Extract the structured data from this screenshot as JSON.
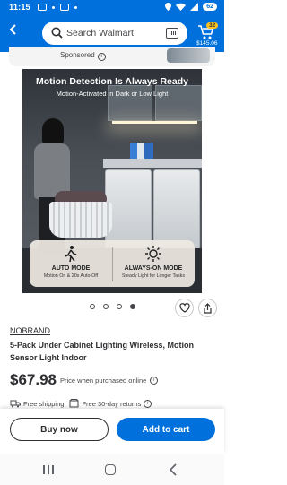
{
  "status_bar": {
    "time": "11:15",
    "battery": "62"
  },
  "header": {
    "search": {
      "placeholder": "Search Walmart"
    },
    "cart": {
      "count": "32",
      "total": "$145.06"
    }
  },
  "sponsored": {
    "label": "Sponsored"
  },
  "product_image": {
    "headline": "Motion Detection Is Always Ready",
    "subheadline": "Motion-Activated in Dark or Low Light",
    "modes": [
      {
        "title": "AUTO MODE",
        "subtitle": "Motion On & 20s Auto-Off",
        "icon": "walking-person-icon"
      },
      {
        "title": "ALWAYS-ON MODE",
        "subtitle": "Steady Light for Longer Tasks",
        "icon": "sun-icon"
      }
    ],
    "carousel_total": 4,
    "carousel_active": 4
  },
  "product": {
    "brand": "NOBRAND",
    "title": "5-Pack Under Cabinet Lighting Wireless, Motion Sensor Light Indoor",
    "price": "$67.98",
    "price_note": "Price when purchased online"
  },
  "badges": {
    "shipping": "Free shipping",
    "returns": "Free 30-day returns"
  },
  "actions": {
    "buy_now": "Buy now",
    "add_to_cart": "Add to cart"
  },
  "colors": {
    "brand_blue": "#0071dc",
    "cart_badge": "#ffc220"
  }
}
